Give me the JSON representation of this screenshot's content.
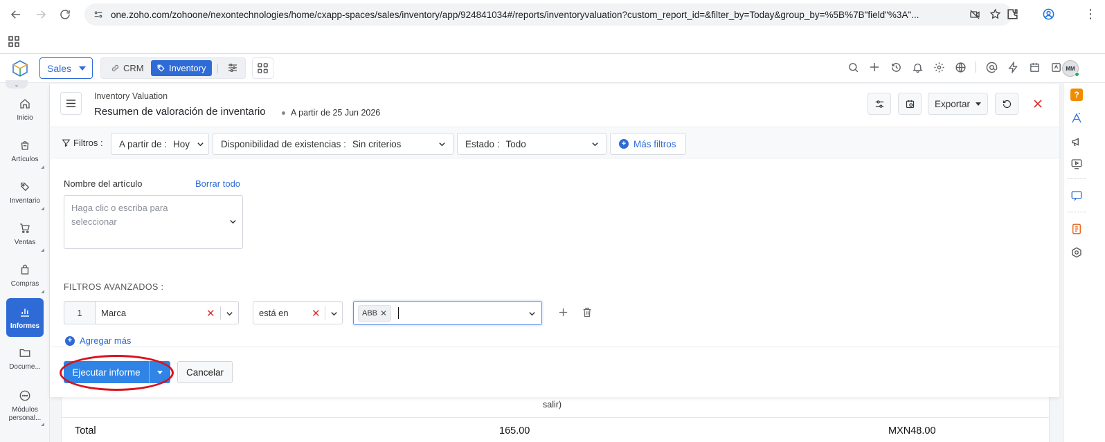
{
  "browser": {
    "url": "one.zoho.com/zohoone/nexontechnologies/home/cxapp-spaces/sales/inventory/app/924841034#/reports/inventoryvaluation?custom_report_id=&filter_by=Today&group_by=%5B%7B\"field\"%3A\"..."
  },
  "header": {
    "space_select": "Sales",
    "module_crm": "CRM",
    "module_inventory": "Inventory",
    "avatar_initials": "MM"
  },
  "sidebar": {
    "items": [
      {
        "label": "Inicio"
      },
      {
        "label": "Artículos"
      },
      {
        "label": "Inventario"
      },
      {
        "label": "Ventas"
      },
      {
        "label": "Compras"
      },
      {
        "label": "Informes"
      },
      {
        "label": "Docume..."
      },
      {
        "label": "Módulos personal..."
      }
    ]
  },
  "report": {
    "breadcrumb": "Inventory Valuation",
    "title": "Resumen de valoración de inventario",
    "as_of": "A partir de 25 Jun 2026",
    "export_label": "Exportar"
  },
  "filters": {
    "label": "Filtros :",
    "as_of_label": "A partir de :",
    "as_of_value": "Hoy",
    "stock_label": "Disponibilidad de existencias :",
    "stock_value": "Sin criterios",
    "status_label": "Estado :",
    "status_value": "Todo",
    "more_filters": "Más filtros"
  },
  "item_filter": {
    "label": "Nombre del artículo",
    "clear_all": "Borrar todo",
    "placeholder": "Haga clic o escriba para seleccionar"
  },
  "advanced": {
    "title": "FILTROS AVANZADOS :",
    "row_number": "1",
    "field": "Marca",
    "operator": "está en",
    "value_tag": "ABB",
    "add_more": "Agregar más"
  },
  "actions": {
    "run_report": "Ejecutar informe",
    "cancel": "Cancelar"
  },
  "table_behind": {
    "wrapped_text": "salir)",
    "total_label": "Total",
    "total_qty": "165.00",
    "total_value": "MXN48.00"
  },
  "colors": {
    "primary": "#2f6bd6",
    "run_button": "#2f84e6",
    "annotation": "#d9121c",
    "danger": "#e03131"
  }
}
